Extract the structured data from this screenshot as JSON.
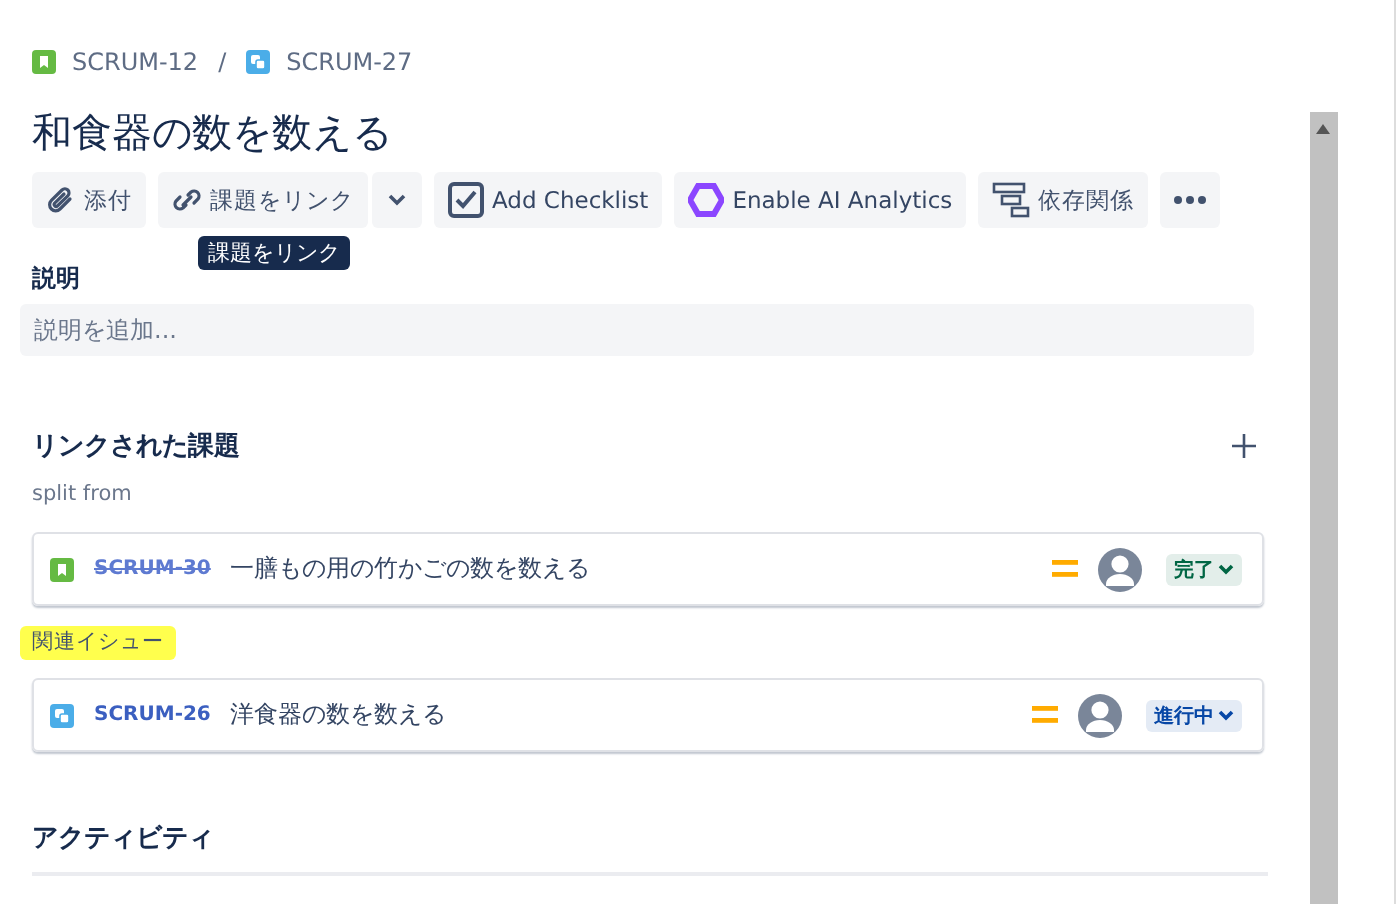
{
  "breadcrumbs": [
    {
      "kind": "story",
      "key": "SCRUM-12"
    },
    {
      "kind": "subtask",
      "key": "SCRUM-27"
    }
  ],
  "breadcrumb_separator": "/",
  "title": "和食器の数を数える",
  "toolbar": [
    {
      "kind": "attach",
      "label": "添付"
    },
    {
      "kind": "link",
      "label": "課題をリンク"
    },
    {
      "kind": "checklist",
      "label": "Add Checklist"
    },
    {
      "kind": "ai",
      "label": "Enable AI Analytics"
    },
    {
      "kind": "dependency",
      "label": "依存関係"
    },
    {
      "kind": "more"
    }
  ],
  "tooltip": "課題をリンク",
  "description": {
    "label": "説明",
    "placeholder": "説明を追加..."
  },
  "linked_issues": {
    "heading": "リンクされた課題",
    "groups": [
      {
        "label": "split from",
        "highlighted": false,
        "issues": [
          {
            "kind": "story",
            "key": "SCRUM-30",
            "done": true,
            "summary": "一膳もの用の竹かごの数を数える",
            "status": "完了",
            "color": "#006644"
          }
        ]
      },
      {
        "label": "関連イシュー",
        "highlighted": true,
        "issues": [
          {
            "kind": "subtask",
            "key": "SCRUM-26",
            "done": false,
            "summary": "洋食器の数を数える",
            "status": "進行中",
            "color": "#0747a6"
          }
        ]
      }
    ]
  },
  "activity": {
    "heading": "アクティビティ"
  }
}
